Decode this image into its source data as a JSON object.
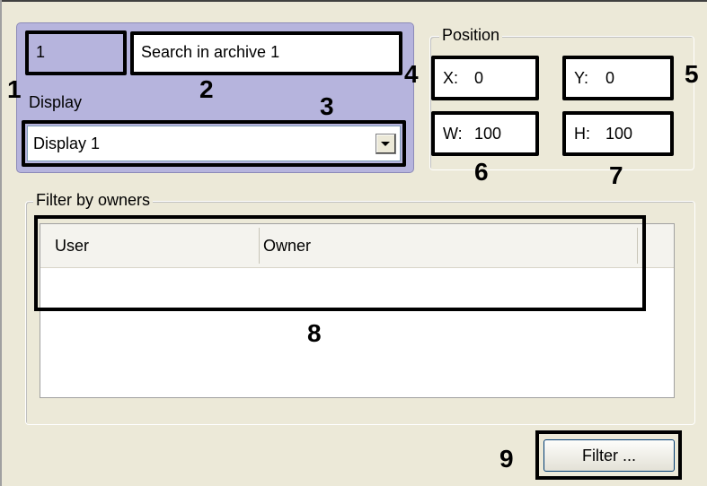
{
  "object_id": "1",
  "object_name": "Search in archive 1",
  "display": {
    "label": "Display",
    "selected": "Display 1"
  },
  "position": {
    "label": "Position",
    "x_prefix": "X:",
    "x_value": "0",
    "y_prefix": "Y:",
    "y_value": "0",
    "w_prefix": "W:",
    "w_value": "100",
    "h_prefix": "H:",
    "h_value": "100"
  },
  "filter_by_owners": {
    "label": "Filter by owners",
    "columns": [
      "User",
      "Owner"
    ],
    "rows": []
  },
  "filter_button": "Filter ...",
  "markers": [
    "1",
    "2",
    "3",
    "4",
    "5",
    "6",
    "7",
    "8",
    "9"
  ]
}
